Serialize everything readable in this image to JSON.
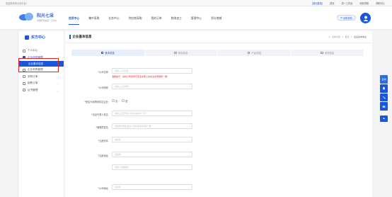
{
  "topbar": {
    "welcome": "欢迎您来到七采平台!",
    "links": [
      "[退出登录]",
      "首页",
      "供一工作台",
      "网站导航",
      "帮助中心"
    ]
  },
  "header": {
    "logo_title": "阳光七采",
    "logo_subtitle": "中国阳光集团一工作台",
    "nav": [
      "会员中心",
      "集中采购",
      "业务中心",
      "供应商采购",
      "我的订单",
      "物流加工",
      "管理中心",
      "积分商城"
    ],
    "active_nav": "会员中心",
    "action_button": "采购采购"
  },
  "sidebar": {
    "title": "买方中心",
    "menu": [
      {
        "label": "个人中心",
        "expandable": true
      },
      {
        "label": "企业信息管理",
        "expandable": false,
        "active": true
      },
      {
        "label": "企业基本信息",
        "sub": true
      },
      {
        "label": "企业采购管理",
        "expandable": true
      },
      {
        "label": "采购订单",
        "expandable": true
      },
      {
        "label": "销售订单",
        "expandable": true
      },
      {
        "label": "证书管理",
        "expandable": true
      }
    ]
  },
  "main": {
    "page_title": "企业基本信息",
    "breadcrumb": [
      "当前位置",
      "首页",
      "企业基本信息"
    ],
    "tabs": [
      "基本信息",
      "服务信息",
      "产品范围",
      "资质信息"
    ],
    "active_tab": "基本信息",
    "form": [
      {
        "label": "公司名称",
        "required": true,
        "placeholder": "请输入公司名称"
      },
      {
        "label": "公司简称",
        "required": true,
        "placeholder": "请输入公司简称"
      },
      {
        "label": "是否为采购商供应企业",
        "required": true,
        "type": "radio",
        "options": [
          "否",
          "是"
        ]
      },
      {
        "label": "法定代表人姓名",
        "required": true,
        "placeholder": "请输入法定代表人姓名(最多10个字)"
      },
      {
        "label": "管理员姓名",
        "required": true,
        "placeholder": "请选择管理员,最多个字并需填写名称一致"
      },
      {
        "label": "注册资本",
        "required": true,
        "placeholder": "请选择"
      },
      {
        "label": "注册地址",
        "required": true,
        "placeholder": "请选择"
      },
      {
        "label": "",
        "required": false,
        "placeholder": "请输入详细地址"
      },
      {
        "label": "公司地址",
        "required": true,
        "placeholder": "请选择"
      }
    ],
    "warning": "温馨提示：请将公司名称与营业执照上的企业名称保持一致！"
  },
  "float_bar": {
    "items": [
      "咨询",
      "客服",
      "电话",
      "邮件"
    ]
  },
  "colors": {
    "accent": "#1a56db",
    "warning": "#e02424"
  }
}
